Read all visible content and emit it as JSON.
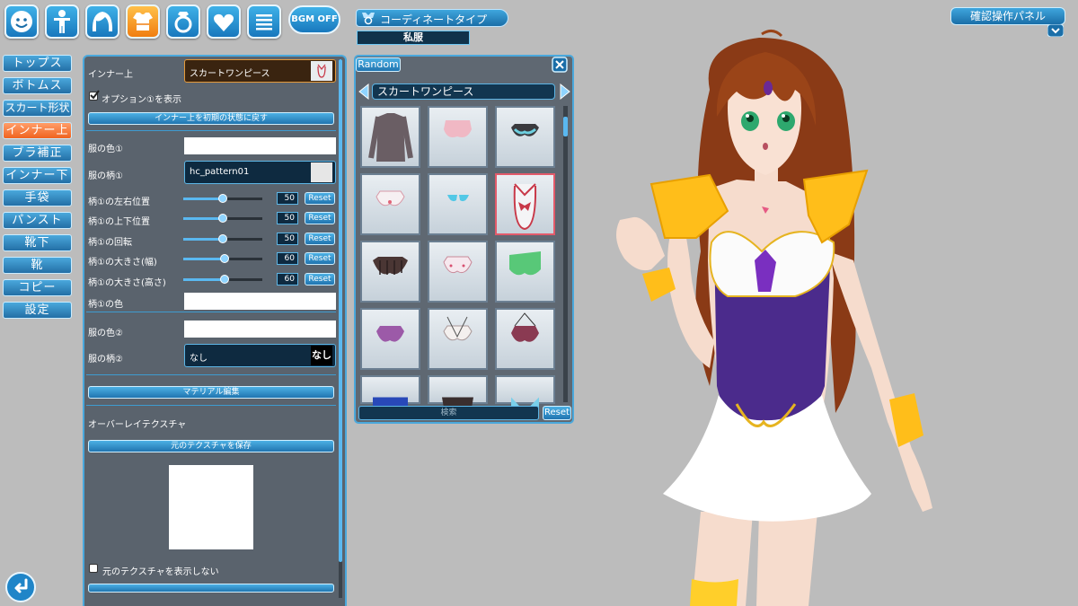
{
  "toolbar": {
    "icons": [
      "face-icon",
      "body-icon",
      "hair-icon",
      "clothes-icon",
      "accessory-icon",
      "heart-icon",
      "menu-icon"
    ],
    "bgm_label": "BGM OFF",
    "accent": "#2a8fd2",
    "active": "#f59a2a"
  },
  "coordinate": {
    "tab_label": "コーディネートタイプ",
    "value": "私服"
  },
  "side_menu": {
    "items": [
      {
        "label": "トップス"
      },
      {
        "label": "ボトムス"
      },
      {
        "label": "スカート形状"
      },
      {
        "label": "インナー上"
      },
      {
        "label": "ブラ補正"
      },
      {
        "label": "インナー下"
      },
      {
        "label": "手袋"
      },
      {
        "label": "パンスト"
      },
      {
        "label": "靴下"
      },
      {
        "label": "靴"
      },
      {
        "label": "コピー"
      },
      {
        "label": "設定"
      }
    ],
    "active_index": 3
  },
  "settings": {
    "inner_top_label": "インナー上",
    "inner_top_value": "スカートワンピース",
    "option1_label": "オプション①を表示",
    "option1_checked": true,
    "reset_inner_label": "インナー上を初期の状態に戻す",
    "color1_label": "服の色①",
    "pattern1_label": "服の柄①",
    "pattern1_value": "hc_pattern01",
    "sliders": [
      {
        "label": "柄①の左右位置",
        "value": "50",
        "reset": "Reset",
        "level": 0.5
      },
      {
        "label": "柄①の上下位置",
        "value": "50",
        "reset": "Reset",
        "level": 0.5
      },
      {
        "label": "柄①の回転",
        "value": "50",
        "reset": "Reset",
        "level": 0.5
      },
      {
        "label": "柄①の大きさ(幅)",
        "value": "60",
        "reset": "Reset",
        "level": 0.6
      },
      {
        "label": "柄①の大きさ(高さ)",
        "value": "60",
        "reset": "Reset",
        "level": 0.6
      }
    ],
    "pattern1_color_label": "柄①の色",
    "color2_label": "服の色②",
    "pattern2_label": "服の柄②",
    "pattern2_value": "なし",
    "pattern2_thumb": "なし",
    "material_edit_label": "マテリアル編集",
    "overlay_label": "オーバーレイテクスチャ",
    "save_texture_label": "元のテクスチャを保存",
    "hide_texture_label": "元のテクスチャを表示しない"
  },
  "picker": {
    "random_label": "Random",
    "category": "スカートワンピース",
    "search_placeholder": "検索",
    "reset_label": "Reset",
    "selected_index": 5
  },
  "confirm_panel": {
    "label": "確認操作パネル"
  }
}
